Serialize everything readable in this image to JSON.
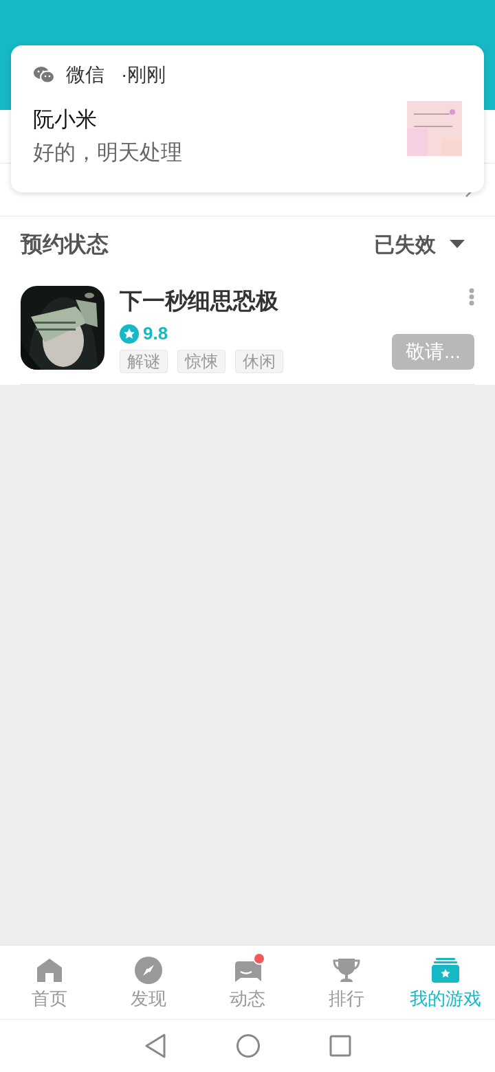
{
  "notification": {
    "app": "微信",
    "time": "·刚刚",
    "sender": "阮小米",
    "message": "好的，明天处理"
  },
  "status_filter": {
    "label": "预约状态",
    "value": "已失效"
  },
  "games": [
    {
      "title": "下一秒细思恐极",
      "rating": "9.8",
      "tags": [
        "解谜",
        "惊悚",
        "休闲"
      ],
      "button": {
        "label": "敬请...",
        "disabled": true
      }
    }
  ],
  "bottom_nav": [
    {
      "label": "首页",
      "selected": false,
      "badge": false
    },
    {
      "label": "发现",
      "selected": false,
      "badge": false
    },
    {
      "label": "动态",
      "selected": false,
      "badge": true
    },
    {
      "label": "排行",
      "selected": false,
      "badge": false
    },
    {
      "label": "我的游戏",
      "selected": true,
      "badge": false
    }
  ]
}
